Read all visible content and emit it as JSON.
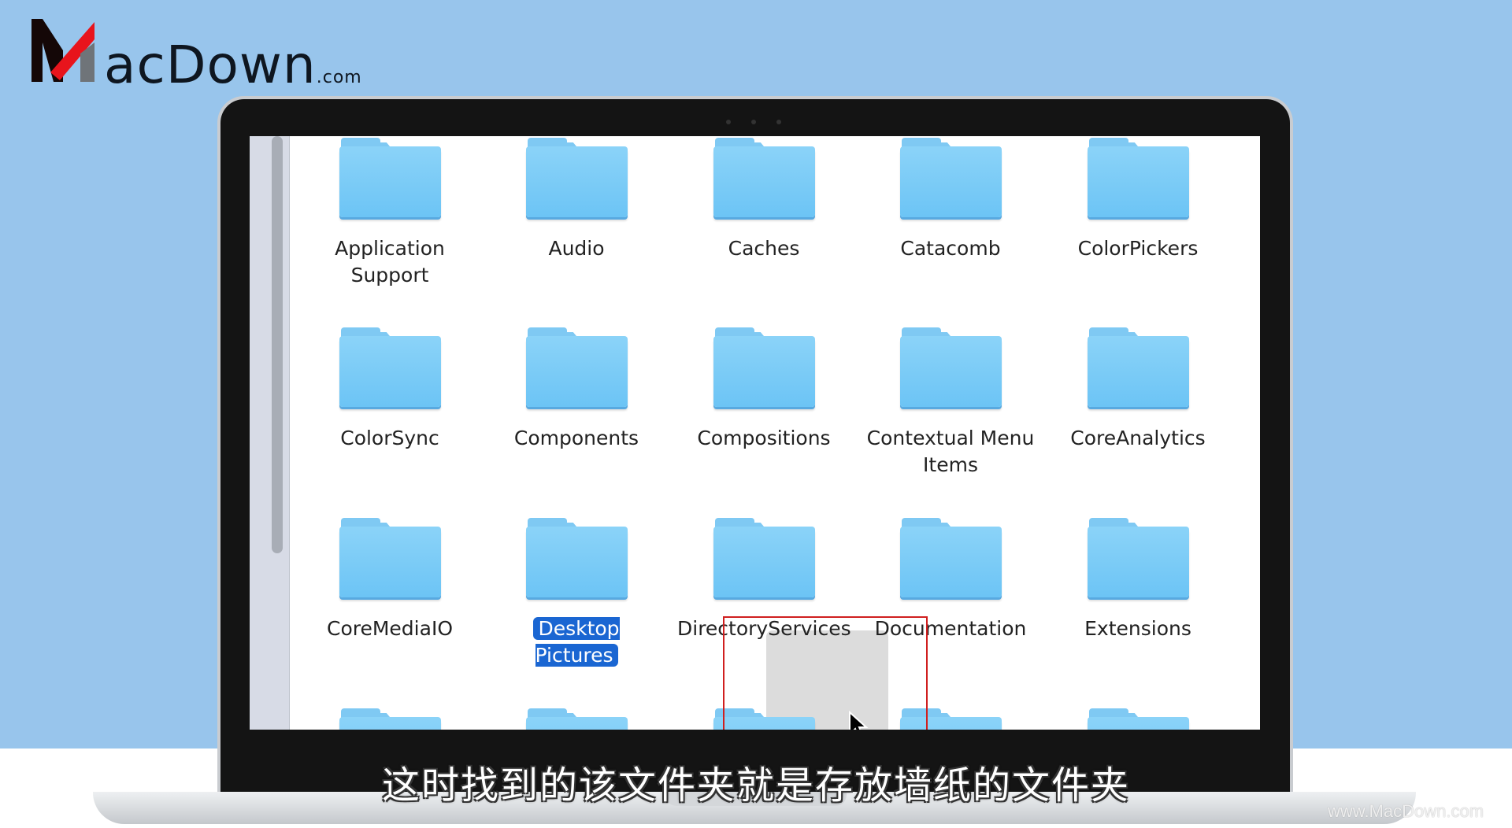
{
  "logo": {
    "text": "acDown",
    "suffix": ".com",
    "brand": "MacDown"
  },
  "folders": [
    {
      "label": "Application Support"
    },
    {
      "label": "Audio"
    },
    {
      "label": "Caches"
    },
    {
      "label": "Catacomb"
    },
    {
      "label": "ColorPickers"
    },
    {
      "label": "ColorSync"
    },
    {
      "label": "Components"
    },
    {
      "label": "Compositions"
    },
    {
      "label": "Contextual Menu Items"
    },
    {
      "label": "CoreAnalytics"
    },
    {
      "label": "CoreMediaIO"
    },
    {
      "label": "Desktop Pictures",
      "selected": true
    },
    {
      "label": "DirectoryServices"
    },
    {
      "label": "Documentation"
    },
    {
      "label": "Extensions"
    }
  ],
  "subtitle": "这时找到的该文件夹就是存放墙纸的文件夹",
  "watermark": "www.MacDown.com",
  "colors": {
    "background": "#98c5ec",
    "selection": "#1a66d2",
    "highlight_box": "#d01f1f",
    "folder": "#7fc9f3"
  }
}
